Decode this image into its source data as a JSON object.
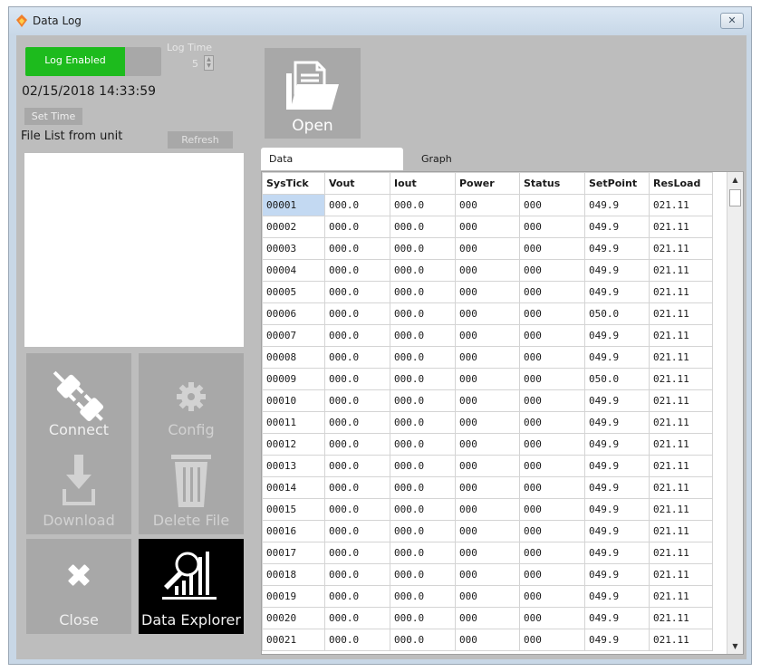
{
  "window": {
    "title": "Data Log"
  },
  "left": {
    "log_toggle": {
      "label": "Log Enabled",
      "enabled": true
    },
    "log_time": {
      "label": "Log Time",
      "value": "5"
    },
    "datetime": "02/15/2018 14:33:59",
    "set_time_label": "Set Time",
    "file_list_label": "File List from unit",
    "refresh_label": "Refresh",
    "file_list_items": [],
    "tiles": {
      "connect": "Connect",
      "config": "Config",
      "download": "Download",
      "delete_file": "Delete File",
      "close": "Close",
      "data_explorer": "Data Explorer"
    }
  },
  "right": {
    "open_label": "Open",
    "tabs": [
      {
        "label": "Data",
        "active": true
      },
      {
        "label": "Graph",
        "active": false
      }
    ],
    "table": {
      "columns": [
        "SysTick",
        "Vout",
        "Iout",
        "Power",
        "Status",
        "SetPoint",
        "ResLoad"
      ],
      "rows": [
        [
          "00001",
          "000.0",
          "000.0",
          "000",
          "000",
          "049.9",
          "021.11"
        ],
        [
          "00002",
          "000.0",
          "000.0",
          "000",
          "000",
          "049.9",
          "021.11"
        ],
        [
          "00003",
          "000.0",
          "000.0",
          "000",
          "000",
          "049.9",
          "021.11"
        ],
        [
          "00004",
          "000.0",
          "000.0",
          "000",
          "000",
          "049.9",
          "021.11"
        ],
        [
          "00005",
          "000.0",
          "000.0",
          "000",
          "000",
          "049.9",
          "021.11"
        ],
        [
          "00006",
          "000.0",
          "000.0",
          "000",
          "000",
          "050.0",
          "021.11"
        ],
        [
          "00007",
          "000.0",
          "000.0",
          "000",
          "000",
          "049.9",
          "021.11"
        ],
        [
          "00008",
          "000.0",
          "000.0",
          "000",
          "000",
          "049.9",
          "021.11"
        ],
        [
          "00009",
          "000.0",
          "000.0",
          "000",
          "000",
          "050.0",
          "021.11"
        ],
        [
          "00010",
          "000.0",
          "000.0",
          "000",
          "000",
          "049.9",
          "021.11"
        ],
        [
          "00011",
          "000.0",
          "000.0",
          "000",
          "000",
          "049.9",
          "021.11"
        ],
        [
          "00012",
          "000.0",
          "000.0",
          "000",
          "000",
          "049.9",
          "021.11"
        ],
        [
          "00013",
          "000.0",
          "000.0",
          "000",
          "000",
          "049.9",
          "021.11"
        ],
        [
          "00014",
          "000.0",
          "000.0",
          "000",
          "000",
          "049.9",
          "021.11"
        ],
        [
          "00015",
          "000.0",
          "000.0",
          "000",
          "000",
          "049.9",
          "021.11"
        ],
        [
          "00016",
          "000.0",
          "000.0",
          "000",
          "000",
          "049.9",
          "021.11"
        ],
        [
          "00017",
          "000.0",
          "000.0",
          "000",
          "000",
          "049.9",
          "021.11"
        ],
        [
          "00018",
          "000.0",
          "000.0",
          "000",
          "000",
          "049.9",
          "021.11"
        ],
        [
          "00019",
          "000.0",
          "000.0",
          "000",
          "000",
          "049.9",
          "021.11"
        ],
        [
          "00020",
          "000.0",
          "000.0",
          "000",
          "000",
          "049.9",
          "021.11"
        ],
        [
          "00021",
          "000.0",
          "000.0",
          "000",
          "000",
          "049.9",
          "021.11"
        ]
      ],
      "selected_cell": "00001"
    }
  },
  "colors": {
    "log_enabled_green": "#1dbb1d",
    "panel_gray": "#bdbdbd",
    "tile_gray": "#a8a8a8",
    "explorer_tile": "#000000",
    "selection_blue": "#c3d9f2"
  },
  "icons": {
    "app": "flame-icon",
    "connect": "plug-icon",
    "config": "gear-icon",
    "download": "download-tray-icon",
    "delete_file": "trash-icon",
    "close": "x-mark-icon",
    "data_explorer": "magnifier-bars-icon",
    "open": "folder-document-icon"
  }
}
